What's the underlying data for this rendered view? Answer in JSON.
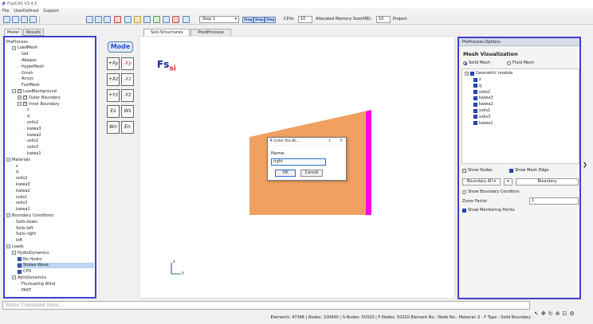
{
  "window": {
    "title": "FssiCAS V3.4.5"
  },
  "menu": [
    "File",
    "UserDefined",
    "Support"
  ],
  "toolbar": {
    "step_value": "Step 1",
    "cpus_label": "CPUs",
    "cpus_value": "10",
    "memory_label": "Allocated Memory Size(MB):",
    "memory_value": "10",
    "project_label": "Project:",
    "step_buttons": [
      "Step",
      "Step",
      "Step"
    ]
  },
  "left_tabs": [
    "Model",
    "Results"
  ],
  "tree": [
    {
      "label": "PreProcess",
      "depth": 0,
      "icon": "none"
    },
    {
      "label": "LoadMesh",
      "depth": 1,
      "icon": "expand-minus"
    },
    {
      "label": "Gid",
      "depth": 2,
      "icon": "dash"
    },
    {
      "label": "Abaqus",
      "depth": 2,
      "icon": "dash"
    },
    {
      "label": "HyperMesh",
      "depth": 2,
      "icon": "dash"
    },
    {
      "label": "Gmsh",
      "depth": 2,
      "icon": "dash"
    },
    {
      "label": "Ansys",
      "depth": 2,
      "icon": "dash"
    },
    {
      "label": "FssiMesh",
      "depth": 2,
      "icon": "dash"
    },
    {
      "label": "LoadBackground",
      "depth": 1,
      "icon": "expand-minus-check"
    },
    {
      "label": "Outer Boundary",
      "depth": 2,
      "icon": "expand-plus-check"
    },
    {
      "label": "Inner Boundary",
      "depth": 2,
      "icon": "expand-minus-check"
    },
    {
      "label": "z",
      "depth": 3,
      "icon": "dash"
    },
    {
      "label": "q",
      "depth": 3,
      "icon": "dash"
    },
    {
      "label": "soils2",
      "depth": 3,
      "icon": "dash"
    },
    {
      "label": "kaiwa3",
      "depth": 3,
      "icon": "dash"
    },
    {
      "label": "kaiwa2",
      "depth": 3,
      "icon": "dash"
    },
    {
      "label": "soils1",
      "depth": 3,
      "icon": "dash"
    },
    {
      "label": "soils3",
      "depth": 3,
      "icon": "dash"
    },
    {
      "label": "kaiwa1",
      "depth": 3,
      "icon": "dash"
    },
    {
      "label": "Materials",
      "depth": 0,
      "icon": "expand-minus"
    },
    {
      "label": "z",
      "depth": 1,
      "icon": "dash"
    },
    {
      "label": "q",
      "depth": 1,
      "icon": "dash"
    },
    {
      "label": "soils2",
      "depth": 1,
      "icon": "dash"
    },
    {
      "label": "kaiwa3",
      "depth": 1,
      "icon": "dash"
    },
    {
      "label": "kaiwa2",
      "depth": 1,
      "icon": "dash"
    },
    {
      "label": "soils1",
      "depth": 1,
      "icon": "dash"
    },
    {
      "label": "soils3",
      "depth": 1,
      "icon": "dash"
    },
    {
      "label": "kaiwa1",
      "depth": 1,
      "icon": "dash"
    },
    {
      "label": "Boundary Conditions",
      "depth": 0,
      "icon": "expand-minus"
    },
    {
      "label": "Soils-down",
      "depth": 1,
      "icon": "dash"
    },
    {
      "label": "Soils-left",
      "depth": 1,
      "icon": "dash"
    },
    {
      "label": "Soils-right",
      "depth": 1,
      "icon": "dash"
    },
    {
      "label": "left",
      "depth": 1,
      "icon": "dash"
    },
    {
      "label": "Loads",
      "depth": 0,
      "icon": "expand-minus"
    },
    {
      "label": "HydroDynamics",
      "depth": 1,
      "icon": "expand-minus"
    },
    {
      "label": "No Hydro",
      "depth": 2,
      "icon": "blue-square"
    },
    {
      "label": "Stokes Wave",
      "depth": 2,
      "icon": "blue-square",
      "selected": true
    },
    {
      "label": "CFD",
      "depth": 2,
      "icon": "blue-square"
    },
    {
      "label": "AeroDynamics",
      "depth": 1,
      "icon": "expand-minus"
    },
    {
      "label": "Fluctuating Wind",
      "depth": 2,
      "icon": "dash"
    },
    {
      "label": "FAST",
      "depth": 2,
      "icon": "dash"
    }
  ],
  "midtools": {
    "mode_label": "Mode",
    "buttons": [
      "+Xy",
      "-Xy",
      "+Xz",
      "-Xz",
      "+Yz",
      "-Yz",
      "Es",
      "Ws",
      "Wn",
      "En"
    ]
  },
  "view_tabs": [
    "Soil-Structures",
    "PostProcess"
  ],
  "viewport": {
    "logo_main": "Fs",
    "logo_sub": "si",
    "axis_z": "z",
    "axis_y": "y",
    "model_color": "#f0a060",
    "edge_color": "#ff00ee"
  },
  "dialog": {
    "title": "Enter the BC...",
    "help": "?",
    "close": "×",
    "label": "Name:",
    "value": "right",
    "ok": "OK",
    "cancel": "Cancel"
  },
  "right_panel": {
    "header": "PreProcess Options",
    "title": "Mesh Visualization",
    "solid_mesh": "Solid Mesh",
    "fluid_mesh": "Fluid Mesh",
    "geometric_module": "Geometric module",
    "geo_items": [
      "z",
      "q",
      "soils2",
      "kaiwa3",
      "kaiwa2",
      "soils1",
      "soils3",
      "kaiwa1"
    ],
    "show_nodes": "Show Nodes",
    "show_mesh_edge": "Show Mesh Edge",
    "boundary_all": "Boundary All",
    "boundary": "Boundary",
    "show_boundary_condition": "Show Boundary Condition",
    "zoom_factor_label": "Zoom Factor",
    "zoom_factor_value": "1",
    "show_monitoring_points": "Show Monitoring Points"
  },
  "command": {
    "placeholder": "Enter Command Here..."
  },
  "status": {
    "text": "Elements: 47346 | Nodes: 100640 | S-Nodes: 50320 | F-Nodes: 50320  Element No.:   Node No.:   Material:   S - F Type :   Solid   Boundary"
  }
}
